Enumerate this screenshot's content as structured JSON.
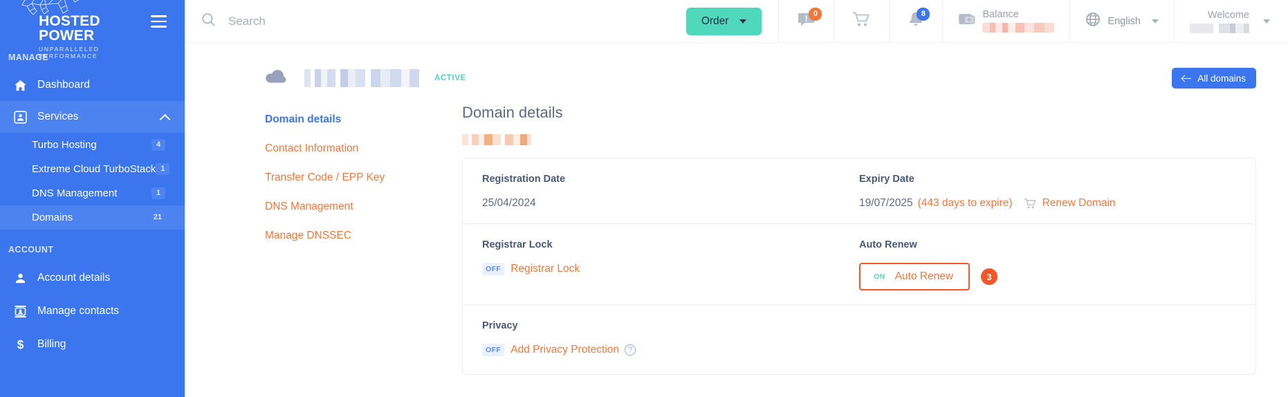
{
  "brand": {
    "name": "HOSTED POWER",
    "tagline": "UNPARALLELED PERFORMANCE",
    "primary_color": "#3b76ef",
    "accent_color": "#f4773a",
    "success_color": "#4fd8bb",
    "highlight_color": "#f4562a"
  },
  "sidebar": {
    "sections": [
      {
        "label": "MANAGE"
      },
      {
        "label": "ACCOUNT"
      }
    ],
    "manage_label": "MANAGE",
    "account_label": "ACCOUNT",
    "dashboard": {
      "label": "Dashboard",
      "icon": "home-icon"
    },
    "services": {
      "label": "Services",
      "icon": "services-icon",
      "expanded": true
    },
    "sub_items": [
      {
        "label": "Turbo Hosting",
        "badge": "4"
      },
      {
        "label": "Extreme Cloud TurboStack",
        "badge": "1"
      },
      {
        "label": "DNS Management",
        "badge": "1"
      },
      {
        "label": "Domains",
        "badge": "21"
      }
    ],
    "account_items": [
      {
        "label": "Account details",
        "icon": "user-icon"
      },
      {
        "label": "Manage contacts",
        "icon": "contact-card-icon"
      },
      {
        "label": "Billing",
        "icon": "dollar-icon"
      }
    ]
  },
  "topbar": {
    "search_placeholder": "Search",
    "search_value": "",
    "order_label": "Order",
    "messages_badge": "0",
    "notifications_badge": "8",
    "balance_label": "Balance",
    "balance_value": "",
    "language_label": "English",
    "welcome_label": "Welcome",
    "welcome_user": ""
  },
  "page": {
    "domain_name": "",
    "status": "ACTIVE",
    "all_domains_label": "All domains"
  },
  "side_menu": [
    {
      "label": "Domain details",
      "active": true
    },
    {
      "label": "Contact Information",
      "active": false
    },
    {
      "label": "Transfer Code / EPP Key",
      "active": false
    },
    {
      "label": "DNS Management",
      "active": false
    },
    {
      "label": "Manage DNSSEC",
      "active": false
    }
  ],
  "details": {
    "title": "Domain details",
    "subtitle_domain": "",
    "registration": {
      "label": "Registration Date",
      "value": "25/04/2024"
    },
    "expiry": {
      "label": "Expiry Date",
      "value": "19/07/2025",
      "days_note": "(443 days to expire)",
      "renew_link": "Renew Domain"
    },
    "registrar_lock": {
      "label": "Registrar Lock",
      "state": "OFF",
      "link": "Registrar Lock"
    },
    "auto_renew": {
      "label": "Auto Renew",
      "state": "ON",
      "link": "Auto Renew",
      "step_marker": "3"
    },
    "privacy": {
      "label": "Privacy",
      "state": "OFF",
      "link": "Add Privacy Protection",
      "help": "?"
    }
  }
}
